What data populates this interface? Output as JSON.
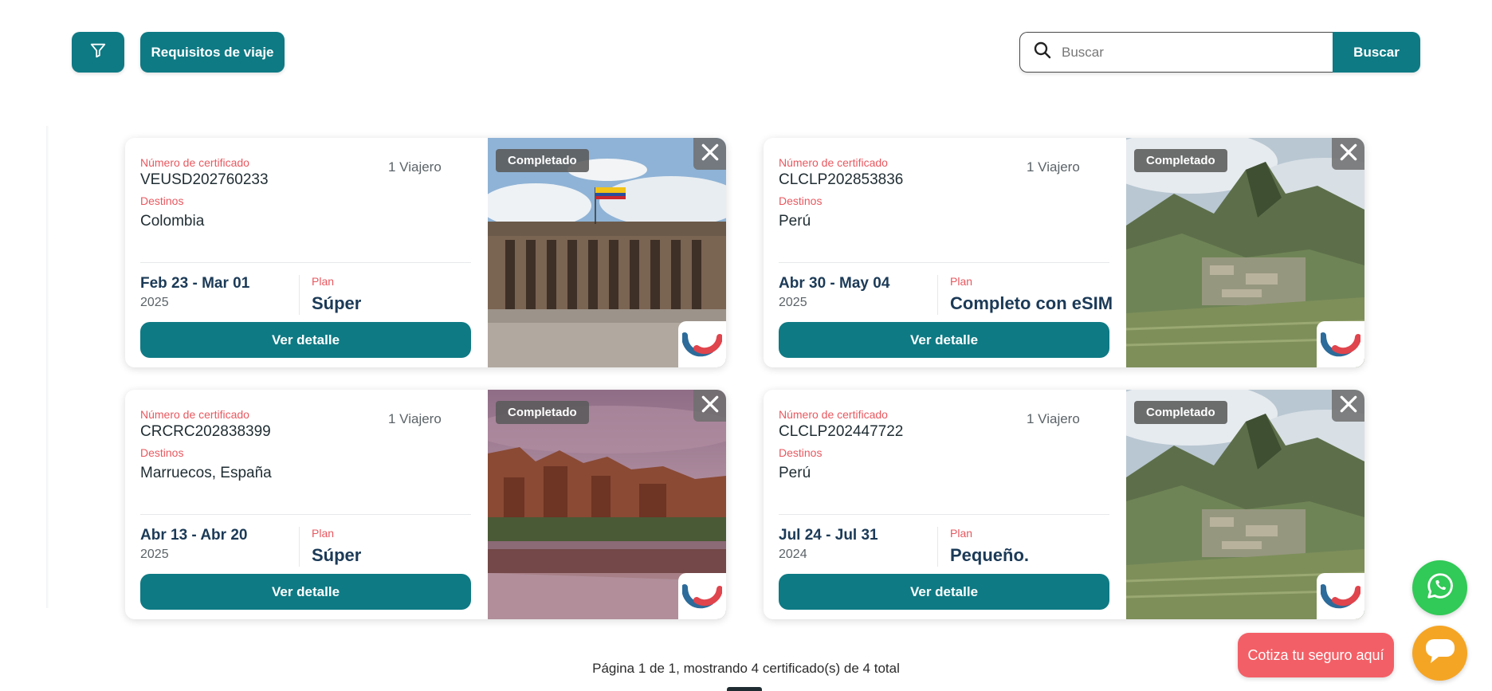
{
  "toolbar": {
    "filter_icon": "funnel-icon",
    "travel_requirements_label": "Requisitos de viaje",
    "search_placeholder": "Buscar",
    "search_value": "",
    "search_button_label": "Buscar"
  },
  "colors": {
    "accent": "#0e7a84",
    "label_red": "#e8585f",
    "dark_text": "#1b3a57",
    "whatsapp": "#31c957",
    "quote": "#f35f66",
    "chat": "#f5a524"
  },
  "cards": [
    {
      "certificate_label": "Número de certificado",
      "certificate_number": "VEUSD202760233",
      "travelers": "1 Viajero",
      "destinations_label": "Destinos",
      "destinations": "Colombia",
      "dates": "Feb 23 - Mar 01",
      "year": "2025",
      "plan_label": "Plan",
      "plan": "Súper",
      "detail_button": "Ver detalle",
      "status": "Completado",
      "image": "colombia-capitol-photo"
    },
    {
      "certificate_label": "Número de certificado",
      "certificate_number": "CLCLP202853836",
      "travelers": "1 Viajero",
      "destinations_label": "Destinos",
      "destinations": "Perú",
      "dates": "Abr 30 - May 04",
      "year": "2025",
      "plan_label": "Plan",
      "plan": "Completo con eSIM",
      "detail_button": "Ver detalle",
      "status": "Completado",
      "image": "machu-picchu-photo"
    },
    {
      "certificate_label": "Número de certificado",
      "certificate_number": "CRCRC202838399",
      "travelers": "1 Viajero",
      "destinations_label": "Destinos",
      "destinations": "Marruecos, España",
      "dates": "Abr 13 - Abr 20",
      "year": "2025",
      "plan_label": "Plan",
      "plan": "Súper",
      "detail_button": "Ver detalle",
      "status": "Completado",
      "image": "morocco-kasbah-photo"
    },
    {
      "certificate_label": "Número de certificado",
      "certificate_number": "CLCLP202447722",
      "travelers": "1 Viajero",
      "destinations_label": "Destinos",
      "destinations": "Perú",
      "dates": "Jul 24 - Jul 31",
      "year": "2024",
      "plan_label": "Plan",
      "plan": "Pequeño.",
      "detail_button": "Ver detalle",
      "status": "Completado",
      "image": "machu-picchu-photo"
    }
  ],
  "pagination": {
    "page_word": "Página",
    "current_page": "1",
    "of_word": "de",
    "total_pages": "1",
    "showing_text": ", mostrando",
    "shown_count": "4",
    "certificates_text": "certificado(s) de",
    "total_count": "4",
    "total_word": "total"
  },
  "floating": {
    "whatsapp_icon": "whatsapp-icon",
    "quote_label": "Cotiza tu seguro aquí",
    "chat_icon": "chat-bubble-icon"
  }
}
